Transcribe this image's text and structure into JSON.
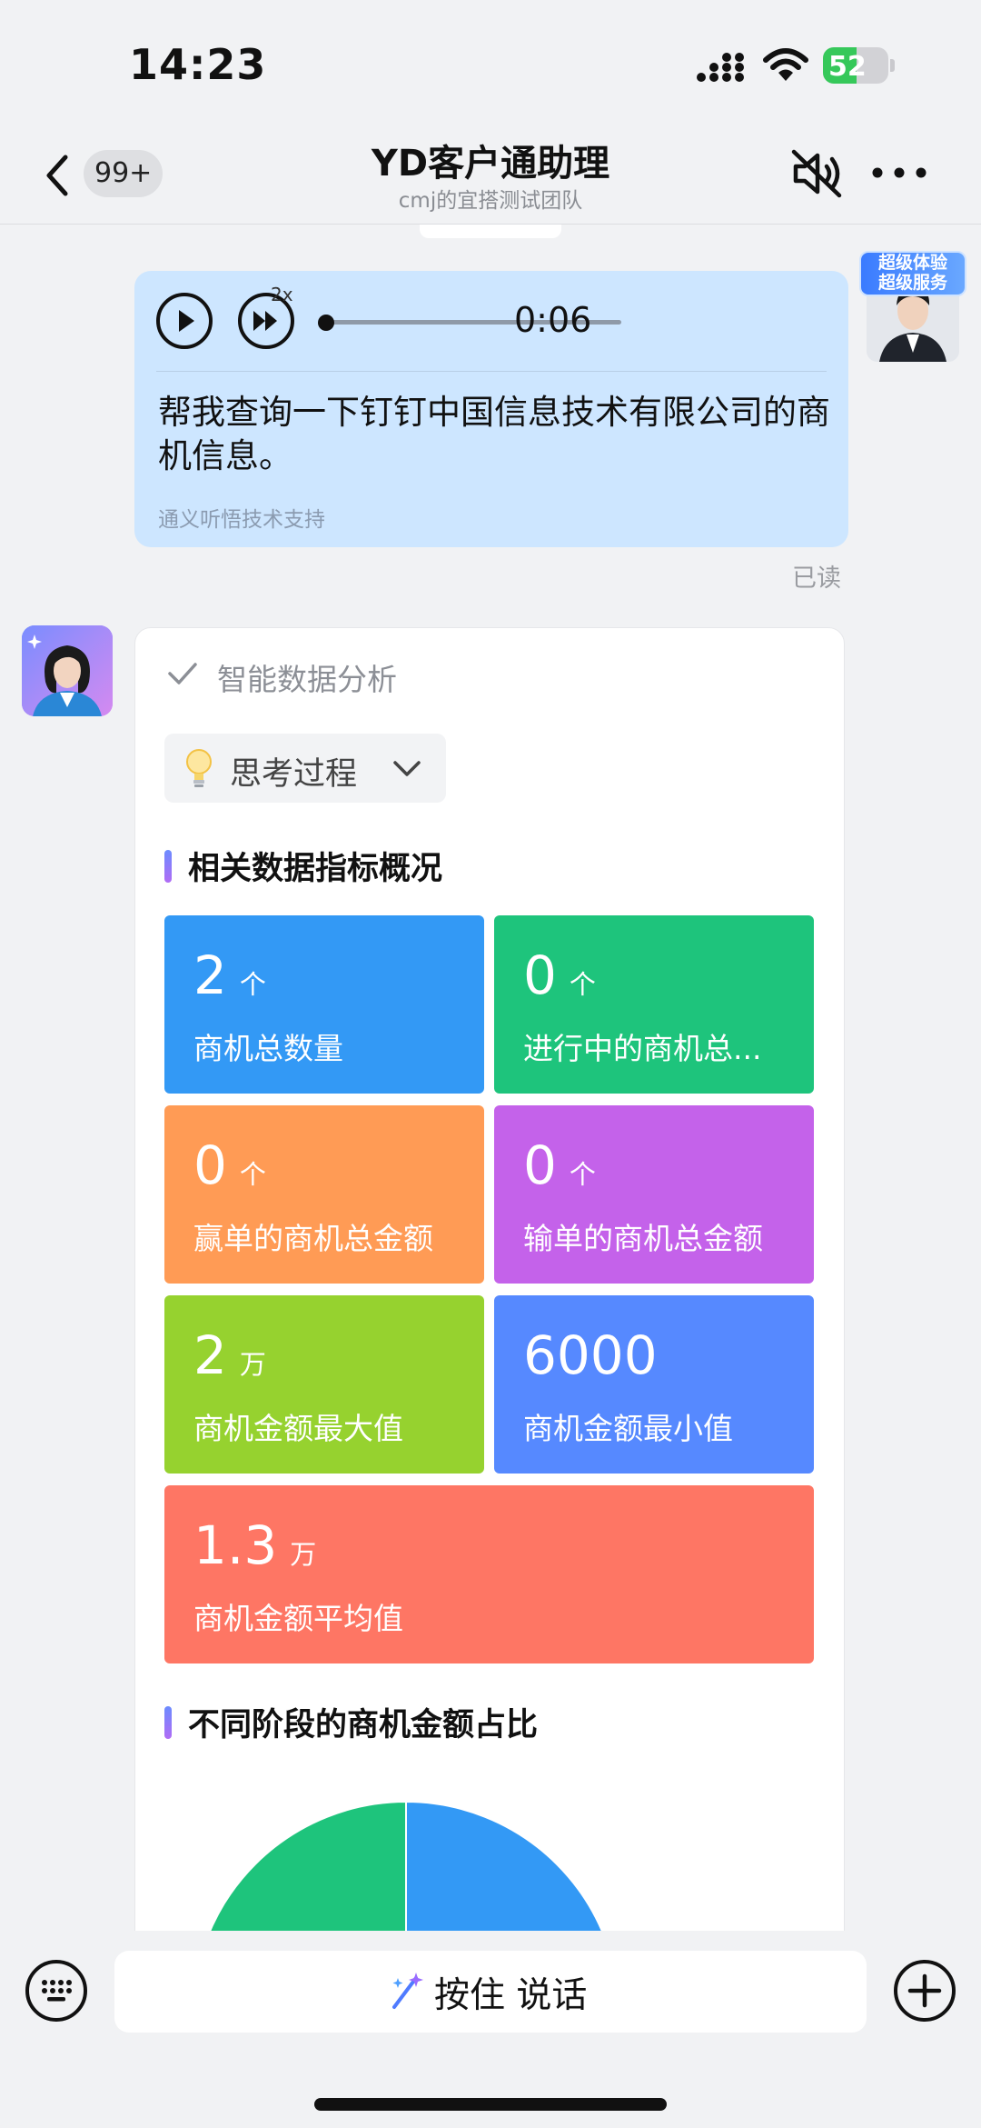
{
  "status_bar": {
    "time": "14:23",
    "battery": "52",
    "battery_level": 0.52
  },
  "nav": {
    "unread_badge": "99+",
    "title": "YD客户通助理",
    "subtitle": "cmj的宜搭测试团队"
  },
  "user_message": {
    "avatar_banner": [
      "超级体验",
      "超级服务"
    ],
    "speed_label": "2x",
    "duration": "0:06",
    "transcript": "帮我查询一下钉钉中国信息技术有限公司的商机信息。",
    "credit": "通义听悟技术支持",
    "read_status": "已读"
  },
  "bot_message": {
    "analysis_label": "智能数据分析",
    "thinking_label": "思考过程",
    "section1_title": "相关数据指标概况",
    "metrics": [
      {
        "value": "2",
        "unit": "个",
        "label": "商机总数量",
        "color": "#3399f5"
      },
      {
        "value": "0",
        "unit": "个",
        "label": "进行中的商机总...",
        "color": "#1ec47c"
      },
      {
        "value": "0",
        "unit": "个",
        "label": "赢单的商机总金额",
        "color": "#ff9b55"
      },
      {
        "value": "0",
        "unit": "个",
        "label": "输单的商机总金额",
        "color": "#c462ea"
      },
      {
        "value": "2",
        "unit": "万",
        "label": "商机金额最大值",
        "color": "#96d22f"
      },
      {
        "value": "6000",
        "unit": "",
        "label": "商机金额最小值",
        "color": "#5689ff"
      },
      {
        "value": "1.3",
        "unit": "万",
        "label": "商机金额平均值",
        "color": "#fe7664"
      }
    ],
    "section2_title": "不同阶段的商机金额占比"
  },
  "chart_data": {
    "type": "pie",
    "title": "不同阶段的商机金额占比",
    "slices": [
      {
        "value": 0.5,
        "color": "#1ec47c"
      },
      {
        "value": 0.5,
        "color": "#3399f5"
      }
    ]
  },
  "input_bar": {
    "hold_to_talk": "按住 说话"
  }
}
